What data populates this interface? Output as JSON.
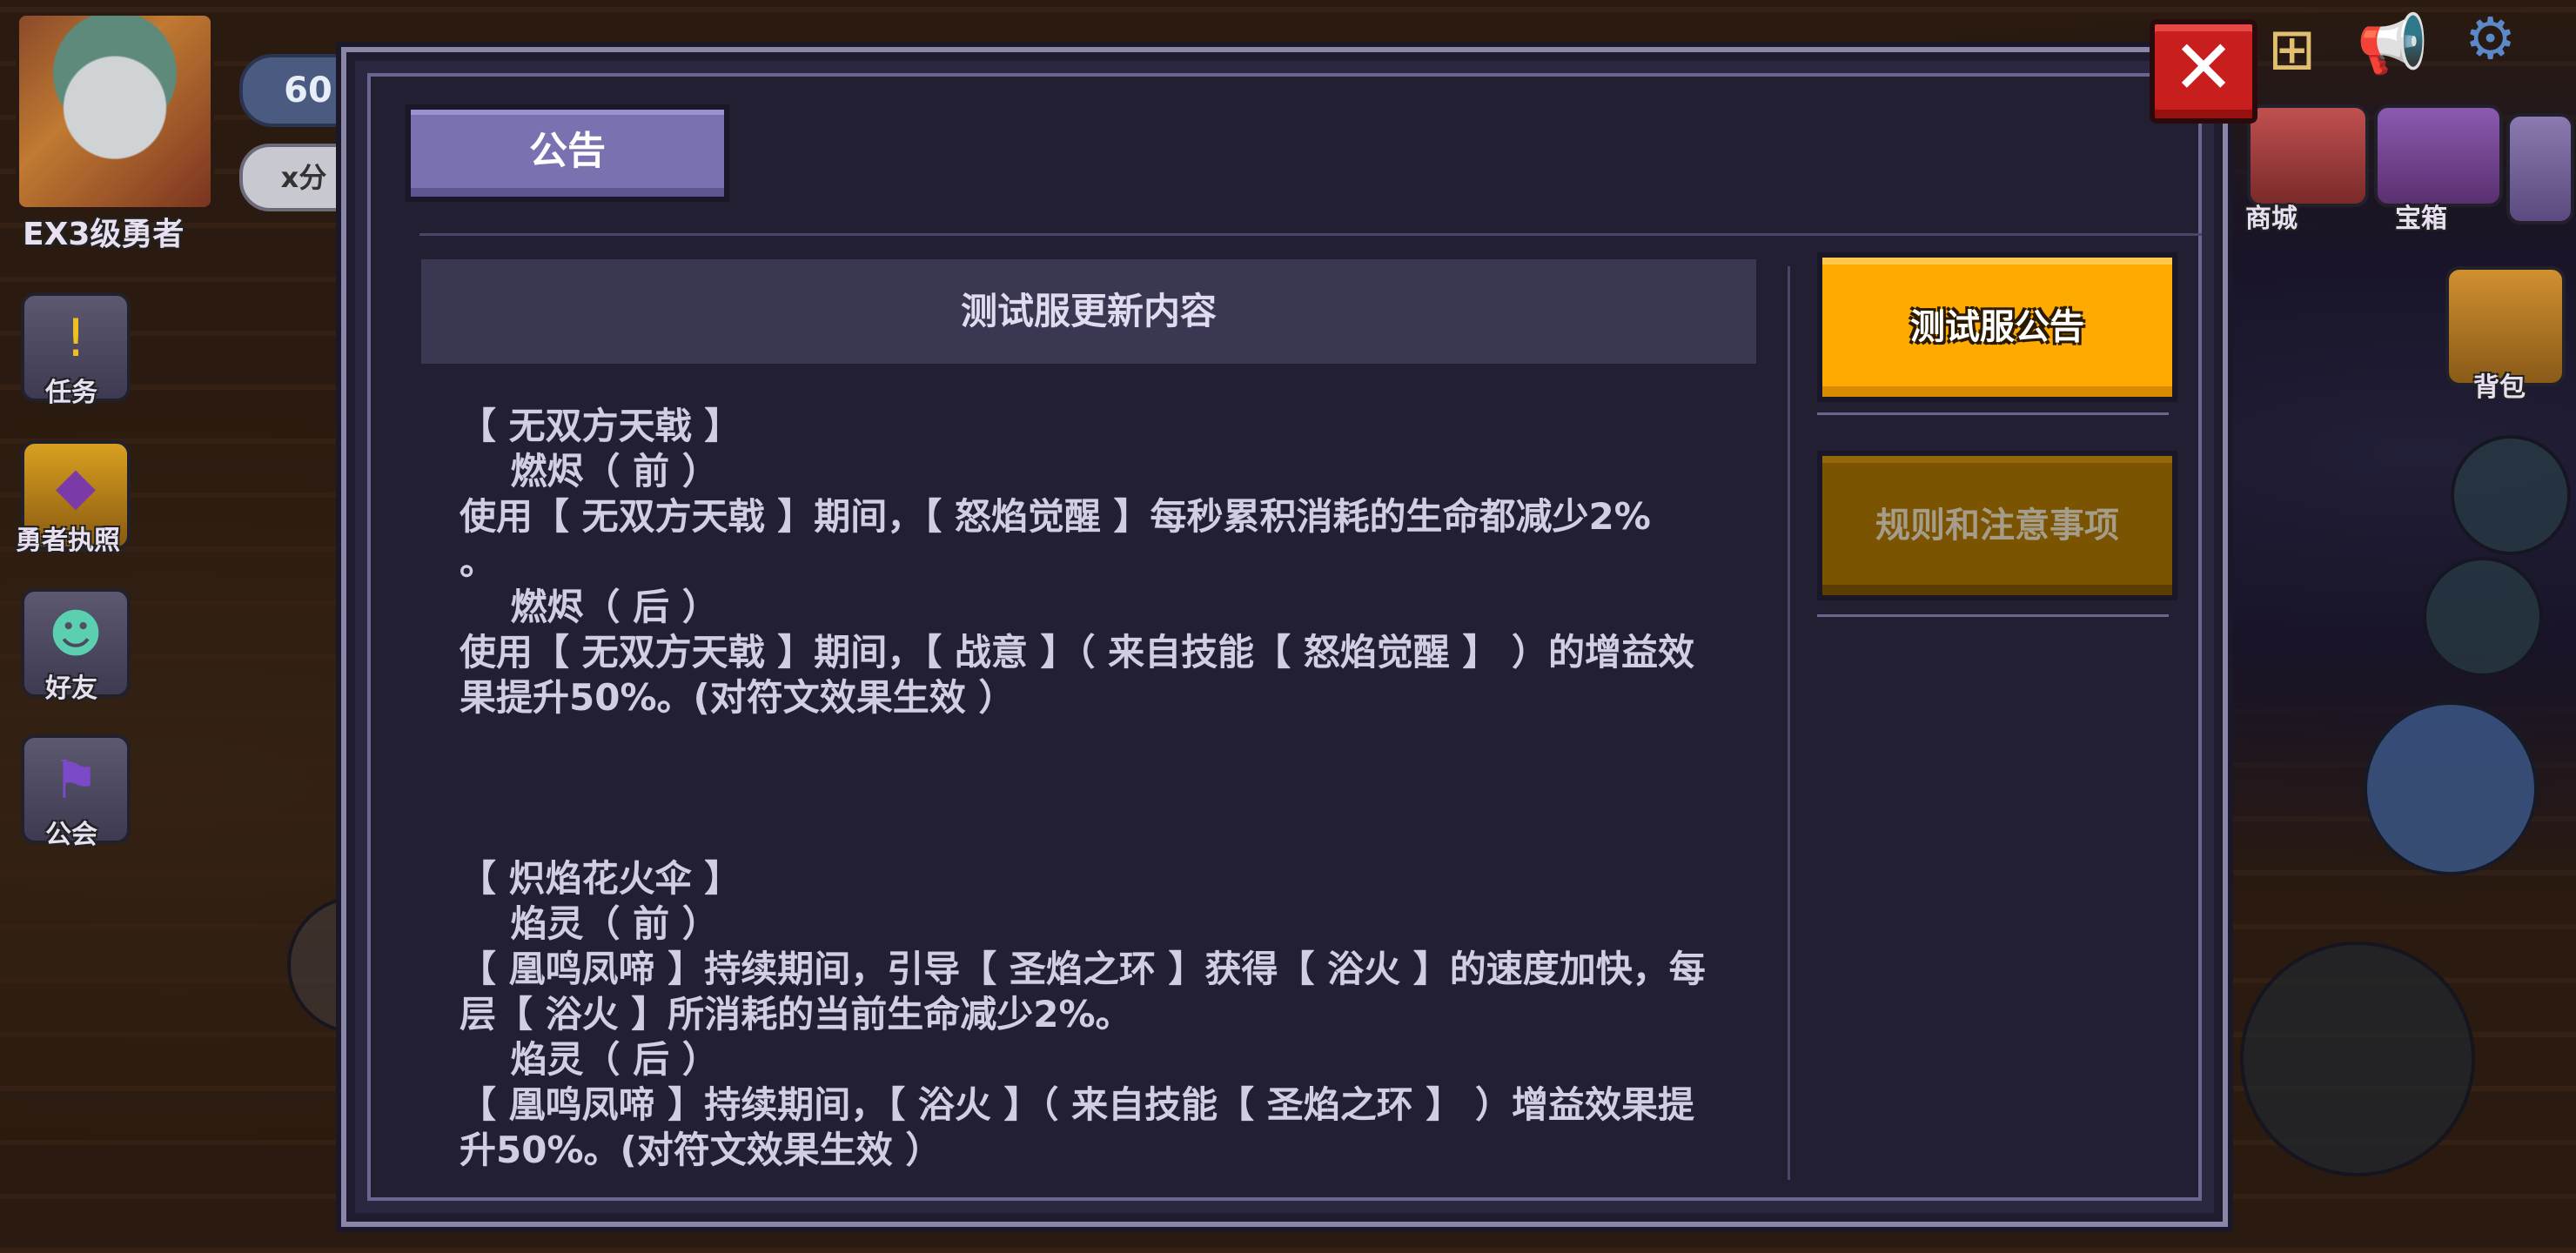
{
  "hud": {
    "player_title": "EX3级勇者",
    "level": "60",
    "score_badge": "x分",
    "left_menu": [
      {
        "label": "任务",
        "icon": "exclamation-icon"
      },
      {
        "label": "勇者执照",
        "icon": "license-icon"
      },
      {
        "label": "好友",
        "icon": "friend-icon"
      },
      {
        "label": "公会",
        "icon": "guild-banner-icon"
      }
    ],
    "right_menu": [
      {
        "label": "商城",
        "icon": "shop-icon"
      },
      {
        "label": "宝箱",
        "icon": "chest-icon"
      },
      {
        "label": "背包",
        "icon": "backpack-icon"
      }
    ]
  },
  "modal": {
    "tab_label": "公告",
    "content_title": "测试服更新内容",
    "content_lines": [
      "【 无双方天戟 】",
      "    燃烬（ 前 ）",
      "使用【 无双方天戟 】期间，【 怒焰觉醒 】每秒累积消耗的生命都减少2%",
      "。",
      "    燃烬（ 后 ）",
      "使用【 无双方天戟 】期间，【 战意 】（ 来自技能【 怒焰觉醒 】 ）的增益效",
      "果提升50%。(对符文效果生效 ）",
      "",
      "",
      "",
      "【 炽焰花火伞 】",
      "    焰灵（ 前 ）",
      "【 凰鸣凤啼 】持续期间，引导【 圣焰之环 】获得【 浴火 】的速度加快，每",
      "层【 浴火 】所消耗的当前生命减少2%。",
      "    焰灵（ 后 ）",
      "【 凰鸣凤啼 】持续期间，【 浴火 】（ 来自技能【 圣焰之环 】 ）增益效果提",
      "升50%。(对符文效果生效 ）"
    ],
    "sidebar_tabs": [
      {
        "label": "测试服公告",
        "active": true
      },
      {
        "label": "规则和注意事项",
        "active": false
      }
    ],
    "close_glyph": "✕"
  },
  "colors": {
    "accent_active": "#ffaa00",
    "accent_inactive": "#7a5400",
    "tab_purple": "#7a72b0",
    "close_red": "#c81e1e"
  }
}
